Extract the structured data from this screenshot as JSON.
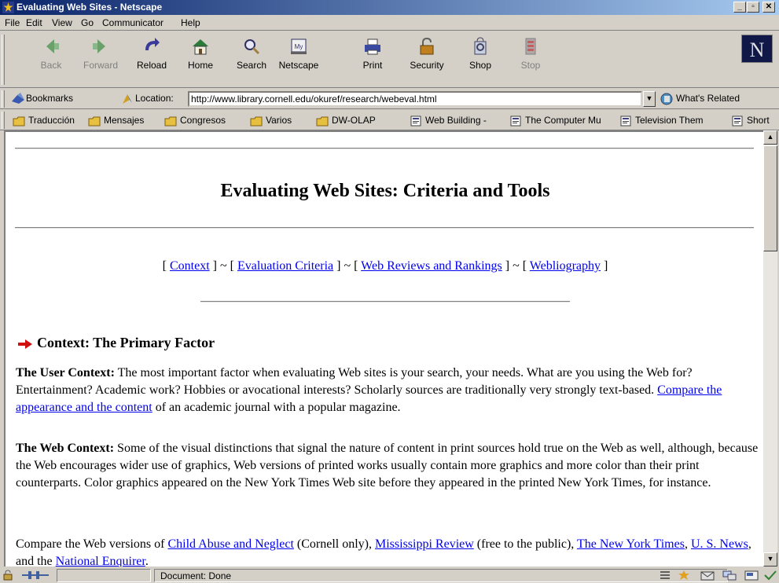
{
  "window": {
    "title": "Evaluating Web Sites - Netscape",
    "app_icon": "netscape-star-icon"
  },
  "menu": [
    "File",
    "Edit",
    "View",
    "Go",
    "Communicator",
    "Help"
  ],
  "toolbar": {
    "back": "Back",
    "forward": "Forward",
    "reload": "Reload",
    "home": "Home",
    "search": "Search",
    "netscape": "Netscape",
    "print": "Print",
    "security": "Security",
    "shop": "Shop",
    "stop": "Stop"
  },
  "location": {
    "bookmarks_label": "Bookmarks",
    "location_label": "Location:",
    "url": "http://www.library.cornell.edu/okuref/research/webeval.html",
    "related_label": "What's Related"
  },
  "personal": [
    "Traducción",
    "Mensajes",
    "Congresos",
    "Varios",
    "DW-OLAP",
    "Web Building -",
    "The Computer Mu",
    "Television Them",
    "Short"
  ],
  "page": {
    "title": "Evaluating Web Sites: Criteria and Tools",
    "nav": {
      "open": "[ ",
      "close_sep": " ] ~ [ ",
      "end": " ]",
      "links": [
        "Context",
        "Evaluation Criteria",
        "Web Reviews and Rankings",
        "Webliography"
      ]
    },
    "section_heading": "Context: The Primary Factor",
    "p1": {
      "label": "The User Context:",
      "text": " The most important factor when evaluating Web sites is your search, your needs. What are you using the Web for? Entertainment? Academic work? Hobbies or avocational interests? Scholarly sources are traditionally very strongly text-based. ",
      "link": "Compare the appearance and the content",
      "tail": " of an academic journal with a popular magazine."
    },
    "p2": {
      "label": "The Web Context:",
      "text": " Some of the visual distinctions that signal the nature of content in print sources hold true on the Web as well, although, because the Web encourages wider use of graphics, Web versions of printed works usually contain more graphics and more color than their print counterparts. Color graphics appeared on the New York Times Web site before they appeared in the printed New York Times, for instance."
    },
    "p3": {
      "lead": "Compare the Web versions of ",
      "link1": "Child Abuse and Neglect",
      "mid1": " (Cornell only), ",
      "link2": "Mississippi Review",
      "mid2": " (free to the public), ",
      "link3": "The New York Times",
      "sep": ", ",
      "link4": "U. S. News",
      "mid3": ", and the ",
      "link5": "National Enquirer",
      "end": "."
    }
  },
  "status": {
    "text": "Document: Done"
  },
  "colors": {
    "title_gradient_start": "#0a246a",
    "title_gradient_end": "#a6caf0",
    "link": "#0000ee",
    "chrome": "#d4d0c8"
  }
}
